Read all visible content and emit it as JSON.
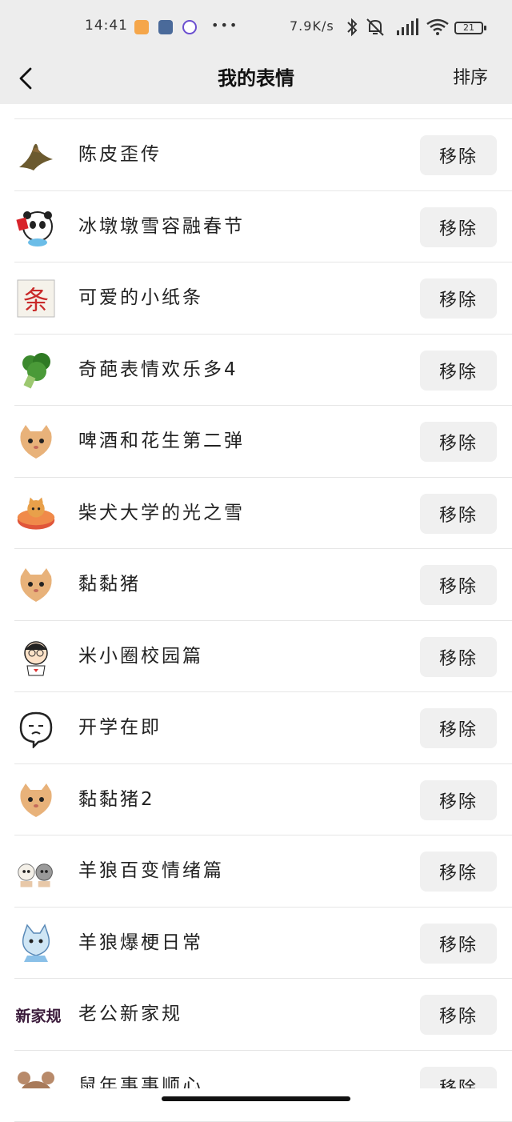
{
  "status_bar": {
    "time": "14:41",
    "dots": "•••",
    "speed": "7.9K/s",
    "battery": "21"
  },
  "nav": {
    "title": "我的表情",
    "sort_label": "排序"
  },
  "remove_label": "移除",
  "items": [
    {
      "name": "陈皮歪传",
      "icon": "bird-sticker-icon"
    },
    {
      "name": "冰墩墩雪容融春节",
      "icon": "panda-sticker-icon"
    },
    {
      "name": "可爱的小纸条",
      "icon": "paper-note-sticker-icon"
    },
    {
      "name": "奇葩表情欢乐多4",
      "icon": "broccoli-sticker-icon"
    },
    {
      "name": "啤酒和花生第二弹",
      "icon": "cat-sticker-icon"
    },
    {
      "name": "柴犬大学的光之雪",
      "icon": "shiba-donut-sticker-icon"
    },
    {
      "name": "黏黏猪",
      "icon": "cat-sticker-icon"
    },
    {
      "name": "米小圈校园篇",
      "icon": "boy-sticker-icon"
    },
    {
      "name": "开学在即",
      "icon": "doodle-face-sticker-icon"
    },
    {
      "name": "黏黏猪2",
      "icon": "cat-sticker-icon"
    },
    {
      "name": "羊狼百变情绪篇",
      "icon": "sheep-wolf-sticker-icon"
    },
    {
      "name": "羊狼爆梗日常",
      "icon": "wolf-sticker-icon"
    },
    {
      "name": "老公新家规",
      "icon": "text-sticker-icon",
      "thumb_text": "新家规"
    },
    {
      "name": "鼠年事事顺心",
      "icon": "mouse-sticker-icon"
    }
  ]
}
